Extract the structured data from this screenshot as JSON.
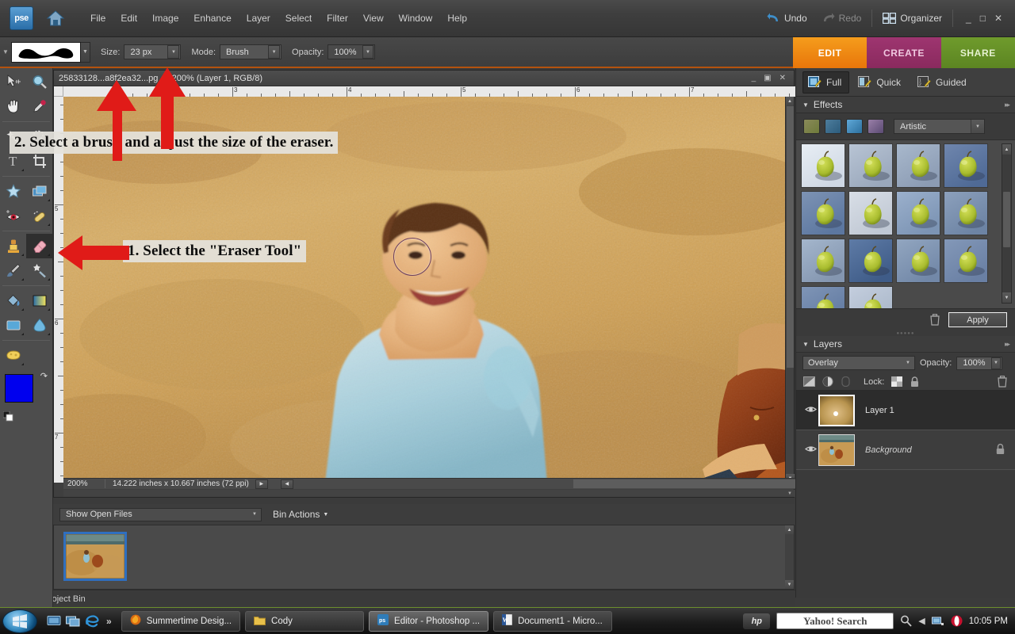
{
  "app": {
    "logo_text": "pse",
    "menu": [
      "File",
      "Edit",
      "Image",
      "Enhance",
      "Layer",
      "Select",
      "Filter",
      "View",
      "Window",
      "Help"
    ],
    "undo_label": "Undo",
    "redo_label": "Redo",
    "organizer_label": "Organizer"
  },
  "options_bar": {
    "size_label": "Size:",
    "size_value": "23 px",
    "mode_label": "Mode:",
    "mode_value": "Brush",
    "opacity_label": "Opacity:",
    "opacity_value": "100%"
  },
  "mode_tabs": [
    {
      "label": "EDIT",
      "color": "#ef8d16",
      "active": true
    },
    {
      "label": "CREATE",
      "color": "#93305f",
      "active": false
    },
    {
      "label": "SHARE",
      "color": "#67922a",
      "active": false
    }
  ],
  "edit_modes": [
    {
      "label": "Full",
      "active": true
    },
    {
      "label": "Quick",
      "active": false
    },
    {
      "label": "Guided",
      "active": false
    }
  ],
  "effects_panel": {
    "title": "Effects",
    "category_value": "Artistic",
    "apply_label": "Apply",
    "thumb_count": 14
  },
  "layers_panel": {
    "title": "Layers",
    "blend_mode": "Overlay",
    "opacity_label": "Opacity:",
    "opacity_value": "100%",
    "lock_label": "Lock:",
    "layers": [
      {
        "name": "Layer 1",
        "selected": true,
        "locked": false,
        "visible": true,
        "italic": false
      },
      {
        "name": "Background",
        "selected": false,
        "locked": true,
        "visible": true,
        "italic": true
      }
    ]
  },
  "document": {
    "title": "25833128...a8f2ea32...pg @ 200% (Layer 1, RGB/8)",
    "zoom": "200%",
    "dimensions": "14.222 inches x 10.667 inches (72 ppi)",
    "ruler_h_marks": [
      "3",
      "4",
      "5",
      "6",
      "7"
    ],
    "ruler_v_marks": [
      "5",
      "6",
      "7"
    ]
  },
  "project_bin": {
    "filter_value": "Show Open Files",
    "actions_label": "Bin Actions",
    "hide_label": "Hide Project Bin"
  },
  "annotations": [
    {
      "id": "step2",
      "text": "2. Select a brush and adjust the size of the eraser."
    },
    {
      "id": "step1",
      "text": "1. Select the \"Eraser Tool\""
    }
  ],
  "tools": [
    "move-tool",
    "zoom-tool",
    "hand-tool",
    "eyedropper-tool",
    "magic-wand-tool",
    "lasso-tool",
    "type-tool",
    "crop-tool",
    "cookie-cutter-tool",
    "straighten-tool",
    "red-eye-tool",
    "healing-brush-tool",
    "clone-stamp-tool",
    "eraser-tool",
    "brush-tool",
    "smart-brush-tool",
    "paint-bucket-tool",
    "gradient-tool",
    "shape-tool",
    "blur-tool",
    "sponge-tool"
  ],
  "colors": {
    "foreground": "#0000ee",
    "background": "#ffffff",
    "accent_orange": "#ef8d16",
    "panel_bg": "#3a3a3a"
  },
  "taskbar": {
    "items": [
      {
        "label": "Summertime Desig...",
        "active": false
      },
      {
        "label": "Cody",
        "active": false
      },
      {
        "label": "Editor - Photoshop ...",
        "active": true
      },
      {
        "label": "Document1 - Micro...",
        "active": false
      }
    ],
    "hp_label": "hp",
    "search_placeholder": "Yahoo! Search",
    "clock": "10:05 PM"
  }
}
